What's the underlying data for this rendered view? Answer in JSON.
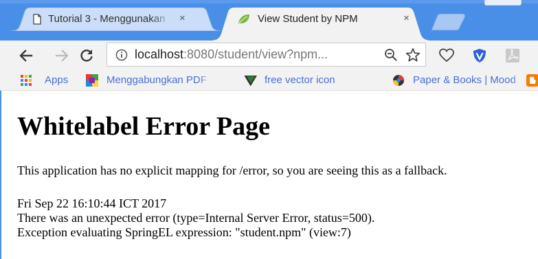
{
  "tabs": [
    {
      "title": "Tutorial 3 - Menggunakan",
      "close": "×",
      "icon": "document-icon",
      "active": false
    },
    {
      "title": "View Student by NPM",
      "close": "×",
      "icon": "spring-leaf-icon",
      "active": true
    }
  ],
  "toolbar": {
    "url_host": "localhost",
    "url_rest": ":8080/student/view?npm...",
    "icons": [
      "back-arrow-icon",
      "forward-arrow-icon",
      "reload-icon",
      "info-icon",
      "zoom-icon",
      "star-icon"
    ],
    "extensions": [
      "heart-icon",
      "shield-icon",
      "pdf-icon"
    ]
  },
  "bookmarks": [
    {
      "label": "Apps",
      "icon": "apps-grid-icon"
    },
    {
      "label": "Menggabungkan PDF",
      "icon": "color-blocks-icon"
    },
    {
      "label": "free vector icon",
      "icon": "vector-v-icon"
    },
    {
      "label": "Paper & Books | Mood",
      "icon": "colorful-ball-icon"
    },
    {
      "label": "",
      "icon": "blogger-icon"
    }
  ],
  "page": {
    "heading": "Whitelabel Error Page",
    "intro": "This application has no explicit mapping for /error, so you are seeing this as a fallback.",
    "timestamp": "Fri Sep 22 16:10:44 ICT 2017",
    "error": "There was an unexpected error (type=Internal Server Error, status=500).",
    "exception": "Exception evaluating SpringEL expression: \"student.npm\" (view:7)"
  },
  "colors": {
    "tabstrip": "#4a8fe7",
    "active_tab": "#f2f2f2",
    "inactive_tab": "#cbddf8",
    "toolbar": "#f2f2f2",
    "shield_ext": "#2f62d8"
  }
}
